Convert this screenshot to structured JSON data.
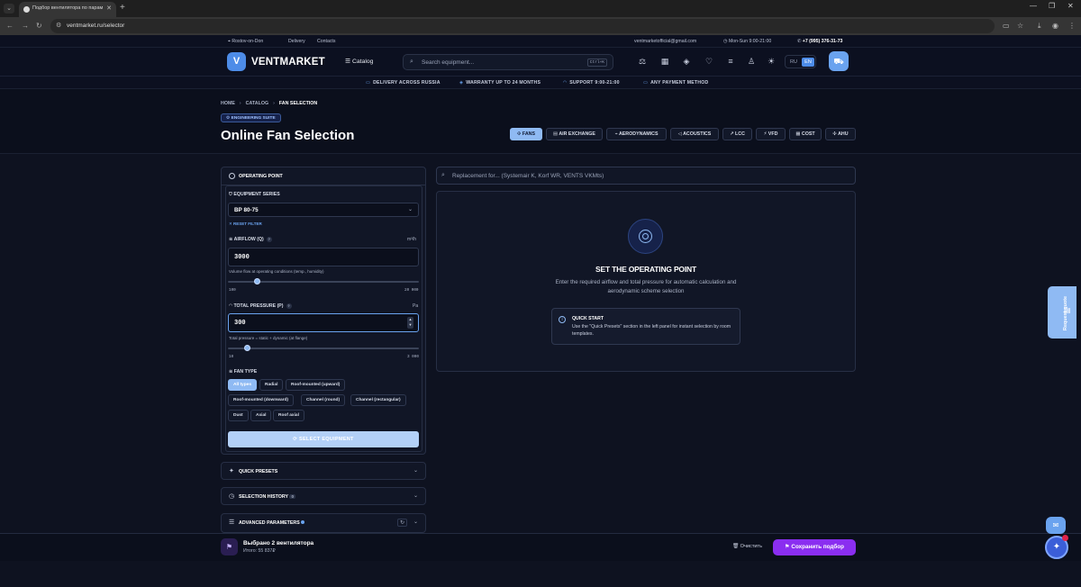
{
  "browser": {
    "tab_title": "Подбор вентилятора по парам...",
    "url": "ventmarket.ru/selector"
  },
  "topstrip": {
    "city": "Rostov-on-Don",
    "delivery": "Delivery",
    "contacts": "Contacts",
    "email": "ventmarketofficial@gmail.com",
    "hours": "Mon-Sun 9:00-21:00",
    "phone": "+7 (995) 376-31-73"
  },
  "header": {
    "logo_letter": "V",
    "logo_text": "VENTMARKET",
    "catalog_label": "Catalog",
    "search_placeholder": "Search equipment...",
    "search_kbd": "Ctrl+K",
    "lang_ru": "RU",
    "lang_en": "EN"
  },
  "benefits": [
    "DELIVERY ACROSS RUSSIA",
    "WARRANTY UP TO 24 MONTHS",
    "SUPPORT 9:00-21:00",
    "ANY PAYMENT METHOD"
  ],
  "breadcrumb": [
    "HOME",
    "CATALOG",
    "FAN SELECTION"
  ],
  "badge": "ENGINEERING SUITE",
  "page_title": "Online Fan Selection",
  "modules": [
    "FANS",
    "AIR EXCHANGE",
    "AERODYNAMICS",
    "ACOUSTICS",
    "LCC",
    "VFD",
    "COST",
    "AHU"
  ],
  "panel": {
    "title": "OPERATING POINT",
    "series_label": "EQUIPMENT SERIES",
    "series_value": "ВР 80-75",
    "reset_filter": "RESET FILTER",
    "airflow_label": "AIRFLOW (Q)",
    "airflow_unit": "m³/h",
    "airflow_value": "3000",
    "airflow_hint": "Volume flow at operating conditions (temp., humidity)",
    "airflow_min": "100",
    "airflow_max": "20 000",
    "airflow_slider": 0.15,
    "pressure_label": "TOTAL PRESSURE (P)",
    "pressure_unit": "Pa",
    "pressure_value": "300",
    "pressure_hint": "Total pressure = static + dynamic (at flange)",
    "pressure_min": "10",
    "pressure_max": "3 000",
    "pressure_slider": 0.1,
    "fan_type_label": "FAN TYPE",
    "fan_types": [
      "All types",
      "Radial",
      "Roof-mounted (upward)",
      "Roof-mounted (downward)",
      "Channel (round)",
      "Channel (rectangular)",
      "Dust",
      "Axial",
      "Roof axial"
    ],
    "select_button": "SELECT EQUIPMENT"
  },
  "accordions": {
    "quick_presets": "QUICK PRESETS",
    "selection_history": "SELECTION HISTORY",
    "history_count": "0",
    "advanced_parameters": "ADVANCED PARAMETERS"
  },
  "result": {
    "replace_placeholder": "Replacement for... (Systemair K, Korf WR, VENTS VKMts)",
    "title": "SET THE OPERATING POINT",
    "description": "Enter the required airflow and total pressure for automatic calculation and aerodynamic scheme selection",
    "qs_title": "QUICK START",
    "qs_text": "Use the \"Quick Presets\" section in the left panel for instant selection by room templates."
  },
  "side_tab": "Request quote",
  "bottombar": {
    "title": "Выбрано 2 вентилятора",
    "subtitle": "Итого: 55 837₽",
    "clear": "Очистить",
    "save": "Сохранить подбор"
  },
  "colors": {
    "accent": "#6aa3ef",
    "accent_light": "#8fbaf3",
    "save_purple": "#8a2ef0",
    "background": "#0e1220"
  }
}
